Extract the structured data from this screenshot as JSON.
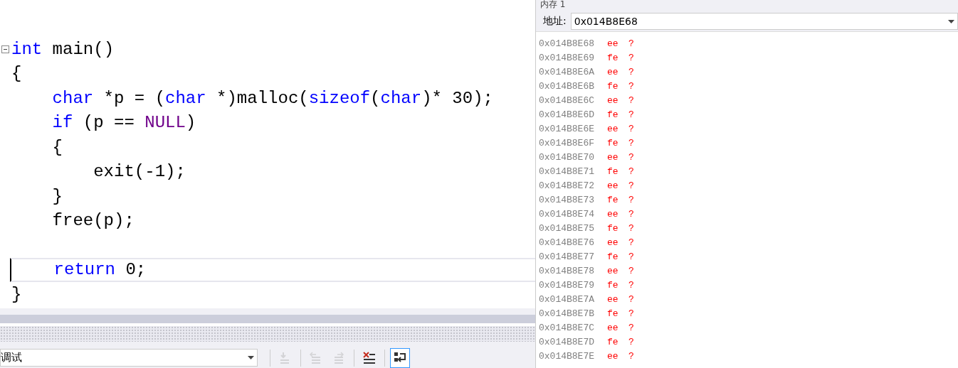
{
  "editor": {
    "lines": [
      {
        "fold": true,
        "current": false,
        "tokens": [
          {
            "kind": "keyword",
            "text": "int"
          },
          {
            "kind": "plain",
            "text": " main()"
          }
        ]
      },
      {
        "current": false,
        "tokens": [
          {
            "kind": "plain",
            "text": "{"
          }
        ]
      },
      {
        "current": false,
        "tokens": [
          {
            "kind": "keyword",
            "text": "    char"
          },
          {
            "kind": "plain",
            "text": " *p = ("
          },
          {
            "kind": "keyword",
            "text": "char"
          },
          {
            "kind": "plain",
            "text": " *)malloc("
          },
          {
            "kind": "keyword",
            "text": "sizeof"
          },
          {
            "kind": "plain",
            "text": "("
          },
          {
            "kind": "keyword",
            "text": "char"
          },
          {
            "kind": "plain",
            "text": ")* 30);"
          }
        ]
      },
      {
        "current": false,
        "tokens": [
          {
            "kind": "keyword",
            "text": "    if"
          },
          {
            "kind": "plain",
            "text": " (p == "
          },
          {
            "kind": "macro",
            "text": "NULL"
          },
          {
            "kind": "plain",
            "text": ")"
          }
        ]
      },
      {
        "current": false,
        "tokens": [
          {
            "kind": "plain",
            "text": "    {"
          }
        ]
      },
      {
        "current": false,
        "tokens": [
          {
            "kind": "plain",
            "text": "        exit(-1);"
          }
        ]
      },
      {
        "current": false,
        "tokens": [
          {
            "kind": "plain",
            "text": "    }"
          }
        ]
      },
      {
        "current": false,
        "tokens": [
          {
            "kind": "plain",
            "text": "    free(p);"
          }
        ]
      },
      {
        "current": false
      },
      {
        "current": true,
        "tokens": [
          {
            "kind": "keyword",
            "text": "    return"
          },
          {
            "kind": "plain",
            "text": " 0;"
          }
        ]
      },
      {
        "current": false,
        "tokens": [
          {
            "kind": "plain",
            "text": "}"
          }
        ]
      }
    ]
  },
  "output_toolbar": {
    "source": "调试",
    "buttons": [
      {
        "kind": "goto",
        "disabled": true,
        "selected": false
      },
      {
        "kind": "prev",
        "disabled": true,
        "selected": false
      },
      {
        "kind": "next",
        "disabled": true,
        "selected": false
      },
      {
        "kind": "clear",
        "disabled": false,
        "selected": false
      },
      {
        "kind": "wrap",
        "disabled": false,
        "selected": true
      }
    ]
  },
  "memory": {
    "title": "内存 1",
    "address_label": "地址:",
    "address": "0x014B8E68",
    "rows": [
      {
        "address": "0x014B8E68",
        "byte": "ee",
        "char": "?"
      },
      {
        "address": "0x014B8E69",
        "byte": "fe",
        "char": "?"
      },
      {
        "address": "0x014B8E6A",
        "byte": "ee",
        "char": "?"
      },
      {
        "address": "0x014B8E6B",
        "byte": "fe",
        "char": "?"
      },
      {
        "address": "0x014B8E6C",
        "byte": "ee",
        "char": "?"
      },
      {
        "address": "0x014B8E6D",
        "byte": "fe",
        "char": "?"
      },
      {
        "address": "0x014B8E6E",
        "byte": "ee",
        "char": "?"
      },
      {
        "address": "0x014B8E6F",
        "byte": "fe",
        "char": "?"
      },
      {
        "address": "0x014B8E70",
        "byte": "ee",
        "char": "?"
      },
      {
        "address": "0x014B8E71",
        "byte": "fe",
        "char": "?"
      },
      {
        "address": "0x014B8E72",
        "byte": "ee",
        "char": "?"
      },
      {
        "address": "0x014B8E73",
        "byte": "fe",
        "char": "?"
      },
      {
        "address": "0x014B8E74",
        "byte": "ee",
        "char": "?"
      },
      {
        "address": "0x014B8E75",
        "byte": "fe",
        "char": "?"
      },
      {
        "address": "0x014B8E76",
        "byte": "ee",
        "char": "?"
      },
      {
        "address": "0x014B8E77",
        "byte": "fe",
        "char": "?"
      },
      {
        "address": "0x014B8E78",
        "byte": "ee",
        "char": "?"
      },
      {
        "address": "0x014B8E79",
        "byte": "fe",
        "char": "?"
      },
      {
        "address": "0x014B8E7A",
        "byte": "ee",
        "char": "?"
      },
      {
        "address": "0x014B8E7B",
        "byte": "fe",
        "char": "?"
      },
      {
        "address": "0x014B8E7C",
        "byte": "ee",
        "char": "?"
      },
      {
        "address": "0x014B8E7D",
        "byte": "fe",
        "char": "?"
      },
      {
        "address": "0x014B8E7E",
        "byte": "ee",
        "char": "?"
      }
    ]
  }
}
